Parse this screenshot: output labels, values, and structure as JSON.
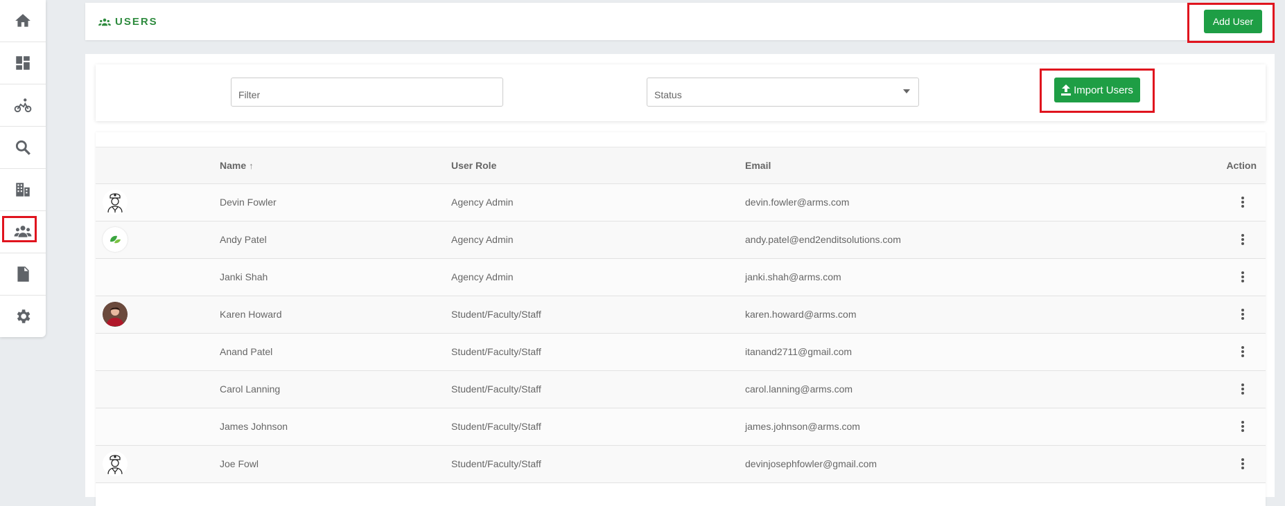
{
  "header": {
    "title": "USERS",
    "add_user_label": "Add User"
  },
  "filters": {
    "filter_placeholder": "Filter",
    "status_placeholder": "Status",
    "import_label": "Import Users"
  },
  "table": {
    "columns": {
      "name": "Name",
      "role": "User Role",
      "email": "Email",
      "action": "Action"
    },
    "rows": [
      {
        "avatar": "officer-icon",
        "name": "Devin Fowler",
        "role": "Agency Admin",
        "email": "devin.fowler@arms.com"
      },
      {
        "avatar": "leaf-logo",
        "name": "Andy Patel",
        "role": "Agency Admin",
        "email": "andy.patel@end2enditsolutions.com"
      },
      {
        "avatar": "",
        "name": "Janki Shah",
        "role": "Agency Admin",
        "email": "janki.shah@arms.com"
      },
      {
        "avatar": "photo",
        "name": "Karen Howard",
        "role": "Student/Faculty/Staff",
        "email": "karen.howard@arms.com"
      },
      {
        "avatar": "",
        "name": "Anand Patel",
        "role": "Student/Faculty/Staff",
        "email": "itanand2711@gmail.com"
      },
      {
        "avatar": "",
        "name": "Carol Lanning",
        "role": "Student/Faculty/Staff",
        "email": "carol.lanning@arms.com"
      },
      {
        "avatar": "",
        "name": "James Johnson",
        "role": "Student/Faculty/Staff",
        "email": "james.johnson@arms.com"
      },
      {
        "avatar": "officer-icon",
        "name": "Joe Fowl",
        "role": "Student/Faculty/Staff",
        "email": "devinjosephfowler@gmail.com"
      }
    ]
  },
  "sidebar": {
    "items": [
      "home-icon",
      "dashboard-icon",
      "bicycle-icon",
      "search-icon",
      "building-icon",
      "users-icon",
      "report-icon",
      "gear-icon"
    ],
    "active": "users-icon"
  },
  "colors": {
    "accent_green": "#1e9e45",
    "highlight_red": "#e0141e"
  }
}
